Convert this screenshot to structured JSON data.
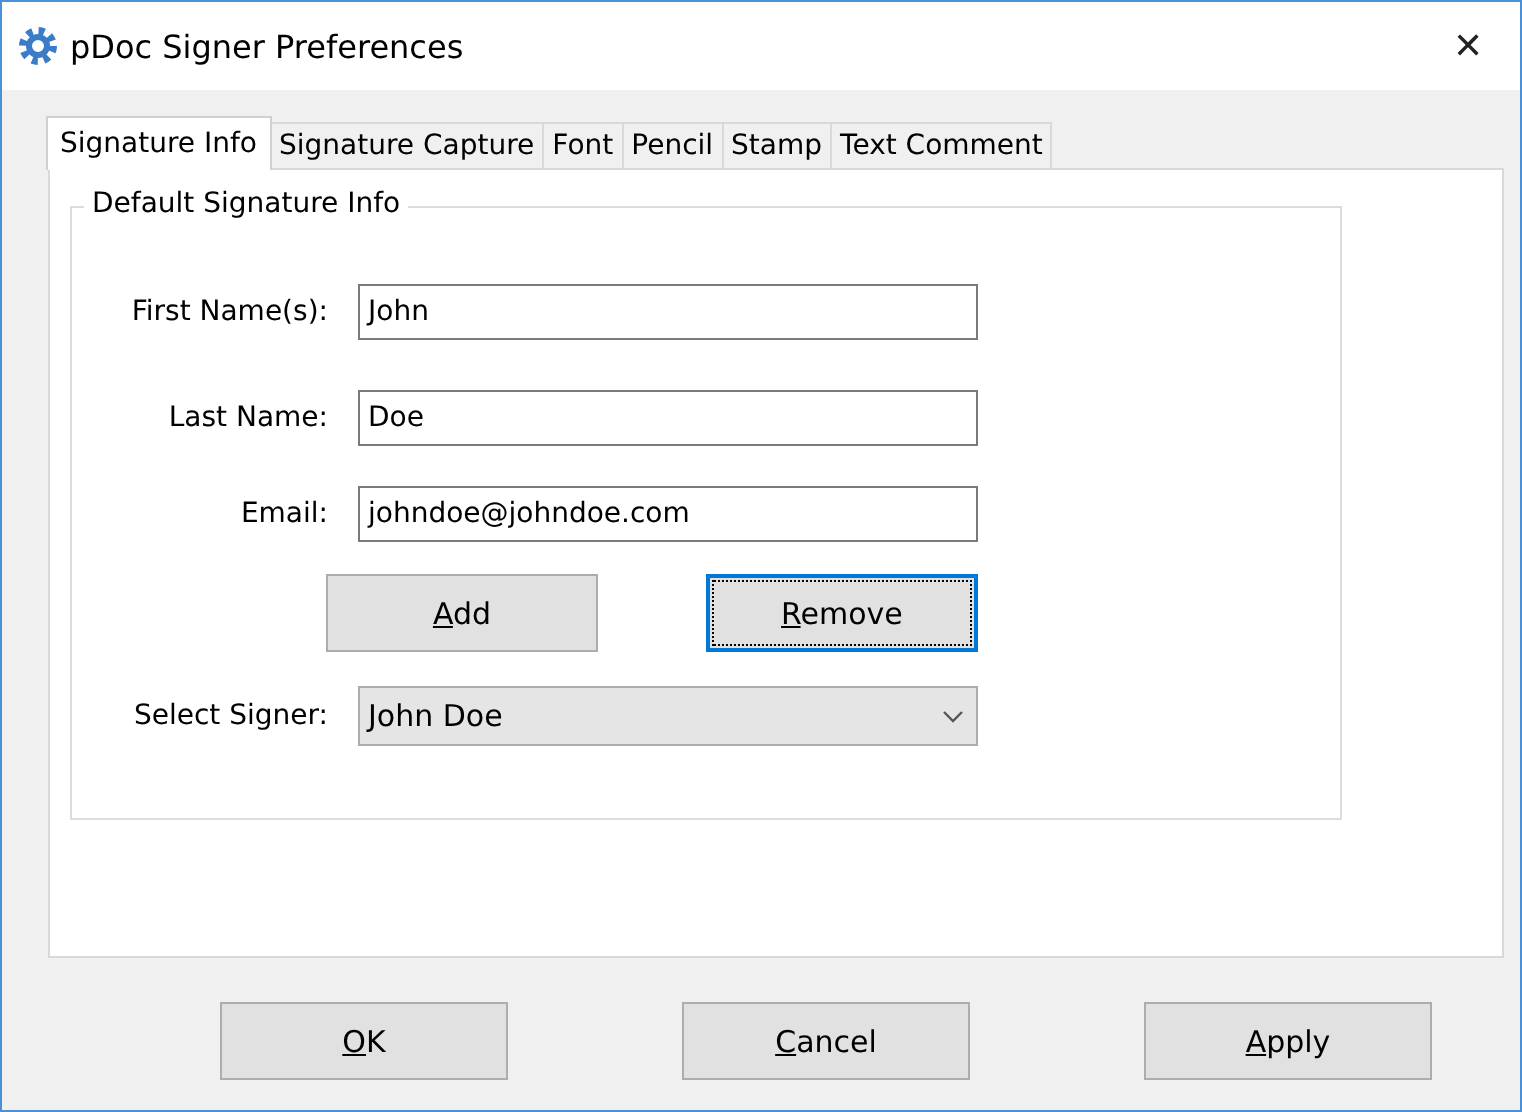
{
  "window": {
    "title": "pDoc Signer Preferences",
    "close": "✕"
  },
  "tabs": [
    {
      "label": "Signature Info",
      "selected": true
    },
    {
      "label": "Signature Capture",
      "selected": false
    },
    {
      "label": "Font",
      "selected": false
    },
    {
      "label": "Pencil",
      "selected": false
    },
    {
      "label": "Stamp",
      "selected": false
    },
    {
      "label": "Text Comment",
      "selected": false
    }
  ],
  "group": {
    "title": "Default Signature Info",
    "fields": [
      {
        "label": "First Name(s):",
        "value": "John"
      },
      {
        "label": "Last Name:",
        "value": "Doe"
      },
      {
        "label": "Email:",
        "value": "johndoe@johndoe.com"
      }
    ],
    "buttons": [
      {
        "key": "A",
        "rest": "dd",
        "focused": false
      },
      {
        "key": "R",
        "rest": "emove",
        "focused": true
      }
    ],
    "select": {
      "label": "Select Signer:",
      "value": "John Doe"
    }
  },
  "footer_buttons": [
    {
      "key": "O",
      "rest": "K"
    },
    {
      "key": "C",
      "rest": "ancel"
    },
    {
      "key": "A",
      "rest": "pply"
    }
  ]
}
